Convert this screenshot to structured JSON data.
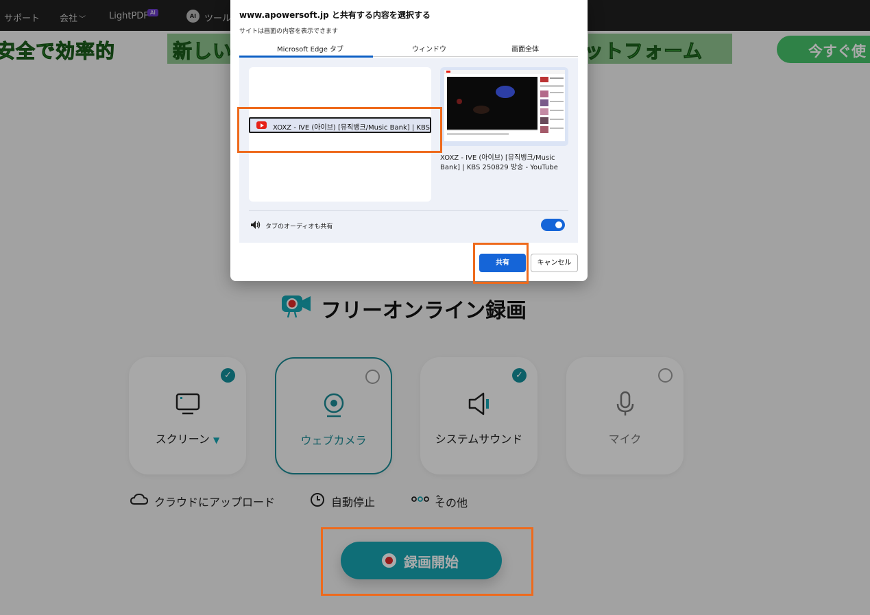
{
  "nav": {
    "items": [
      {
        "label": "サポート",
        "chevron": false
      },
      {
        "label": "会社",
        "chevron": true
      },
      {
        "label": "LightPDF",
        "chevron": false
      },
      {
        "label": "ツール",
        "chevron": false
      }
    ],
    "ai_badge": "AI",
    "ai_gear_label": "AI"
  },
  "banner": {
    "left_text": "安全で効率的",
    "middle_text": "新しい",
    "right_text": "ットフォーム",
    "cta_label": "今すぐ使"
  },
  "main": {
    "title": "フリーオンライン録画",
    "options": [
      {
        "label": "スクリーン",
        "checked": true,
        "selected": false
      },
      {
        "label": "ウェブカメラ",
        "checked": false,
        "selected": true
      },
      {
        "label": "システムサウンド",
        "checked": true,
        "selected": false
      },
      {
        "label": "マイク",
        "checked": false,
        "selected": false
      }
    ],
    "bottom_options": {
      "cloud": "クラウドにアップロード",
      "auto_stop": "自動停止",
      "more": "その他"
    },
    "record_label": "録画開始"
  },
  "dialog": {
    "title": "www.apowersoft.jp と共有する内容を選択する",
    "subtitle": "サイトは画面の内容を表示できます",
    "tabs": [
      "Microsoft Edge タブ",
      "ウィンドウ",
      "画面全体"
    ],
    "active_tab": 0,
    "tab_item": "XOXZ - IVE (아이브) [뮤직뱅크/Music Bank] | KBS",
    "preview_title": "XOXZ - IVE (아이브) [뮤직뱅크/Music Bank] | KBS 250829 방송 - YouTube",
    "audio_label": "タブのオーディオも共有",
    "audio_enabled": true,
    "share_label": "共有",
    "cancel_label": "キャンセル"
  },
  "colors": {
    "accent_teal": "#17a5b2",
    "dialog_primary": "#1565d8",
    "highlight_orange": "#ee6a1c"
  }
}
